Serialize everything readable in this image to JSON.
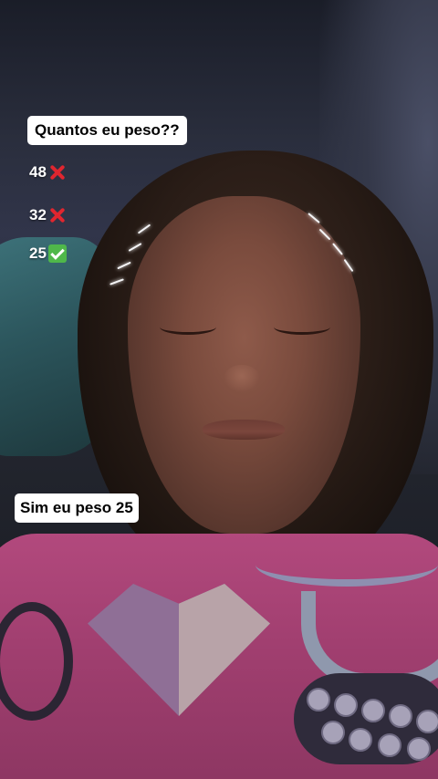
{
  "overlay": {
    "question": "Quantos eu peso??",
    "answers": [
      {
        "value": "48",
        "mark": "x-mark-icon"
      },
      {
        "value": "32",
        "mark": "x-mark-icon"
      },
      {
        "value": "25",
        "mark": "check-mark-icon"
      }
    ],
    "statement": "Sim eu peso 25"
  },
  "colors": {
    "sticker_bg": "#ffffff",
    "wrong": "#e0262f",
    "right": "#4fb84a",
    "shirt": "#b2497d"
  }
}
